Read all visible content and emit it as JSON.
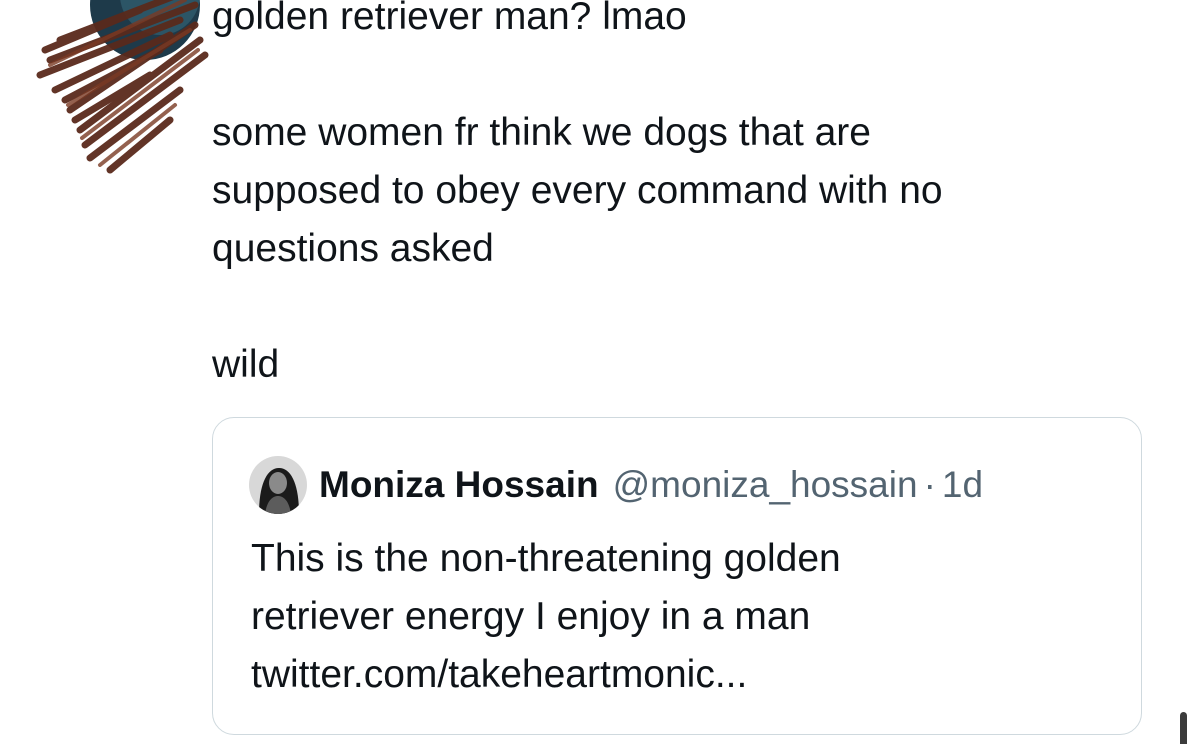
{
  "tweet": {
    "lines": [
      "golden retriever man? lmao",
      "some women fr think we dogs that are",
      "supposed to obey every command with no",
      "questions asked",
      "wild"
    ]
  },
  "quoted_tweet": {
    "author_name": "Moniza Hossain",
    "author_handle": "@moniza_hossain",
    "separator": "·",
    "timestamp": "1d",
    "lines": [
      "This is the non-threatening golden",
      "retriever energy I enjoy in a man",
      "twitter.com/takeheartmonic..."
    ]
  },
  "colors": {
    "text_primary": "#0f1419",
    "text_secondary": "#536471",
    "card_border": "#cfd9de",
    "scribble": "#5a2a1c"
  },
  "icons": {
    "redacted_avatar": "scribbled-avatar-icon",
    "quoted_avatar": "profile-photo-avatar"
  }
}
